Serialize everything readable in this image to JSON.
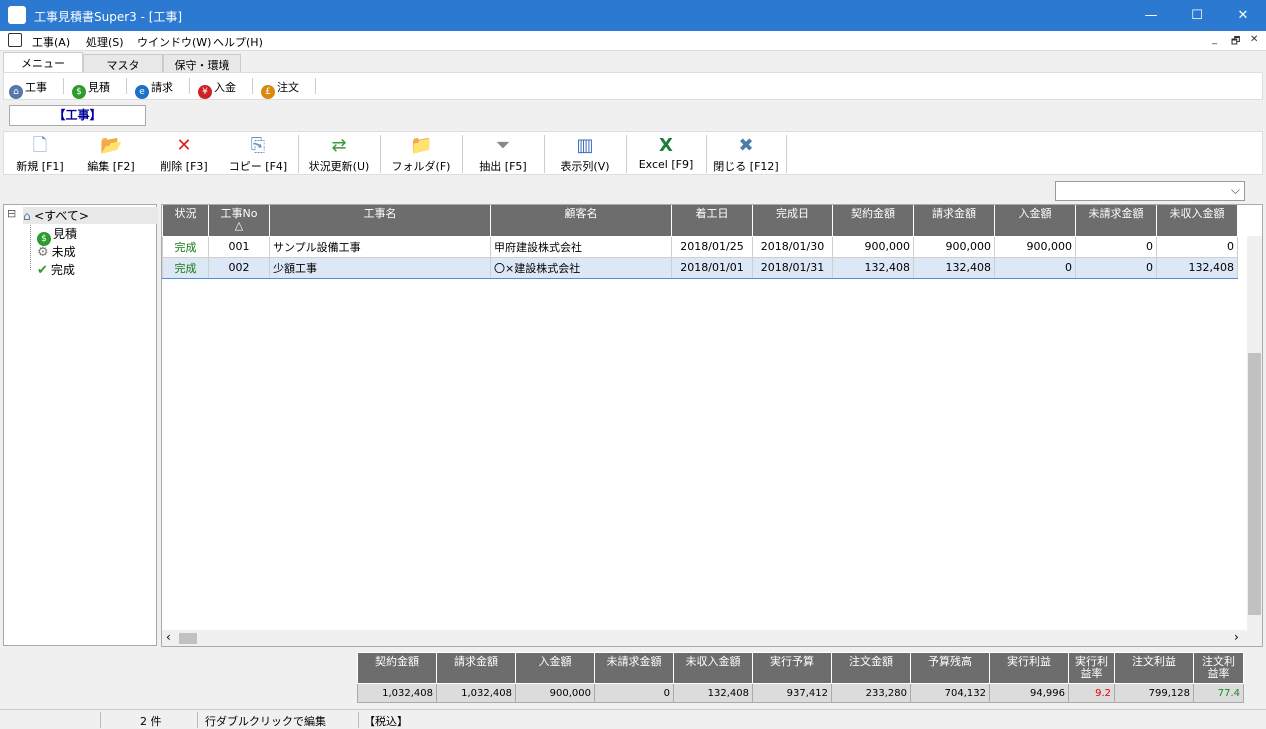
{
  "window": {
    "title": "工事見積書Super3 - [工事]",
    "minimize": "—",
    "maximize": "☐",
    "close": "✕"
  },
  "menu": {
    "items": [
      "工事(A)",
      "処理(S)",
      "ウインドウ(W)",
      "ヘルプ(H)"
    ],
    "mdi": [
      "_",
      "🗗",
      "✕"
    ]
  },
  "tabs": [
    "メニュー",
    "マスタ",
    "保守・環境"
  ],
  "quick": [
    {
      "label": "工事",
      "icon": "house-icon",
      "color": "#5577aa",
      "glyph": "⌂"
    },
    {
      "label": "見積",
      "icon": "dollar-icon",
      "color": "#2e9b2e",
      "glyph": "$"
    },
    {
      "label": "請求",
      "icon": "invoice-icon",
      "color": "#1e6fc8",
      "glyph": "e"
    },
    {
      "label": "入金",
      "icon": "yen-icon",
      "color": "#cc2222",
      "glyph": "¥"
    },
    {
      "label": "注文",
      "icon": "order-icon",
      "color": "#d98a0e",
      "glyph": "£"
    }
  ],
  "mode_label": "【工事】",
  "toolbar": [
    {
      "label": "新規 [F1]",
      "icon": "new-document-icon",
      "glyph": "🗋",
      "color": "#7a9cc8"
    },
    {
      "label": "編集 [F2]",
      "icon": "edit-folder-icon",
      "glyph": "📂",
      "color": "#d6a51c"
    },
    {
      "label": "削除 [F3]",
      "icon": "delete-icon",
      "glyph": "✕",
      "color": "#e02020"
    },
    {
      "label": "コピー [F4]",
      "icon": "copy-icon",
      "glyph": "⎘",
      "color": "#6a8fc0"
    },
    {
      "label": "状況更新(U)",
      "icon": "refresh-icon",
      "glyph": "⇄",
      "color": "#3a9a3a"
    },
    {
      "label": "フォルダ(F)",
      "icon": "folder-icon",
      "glyph": "📁",
      "color": "#d6a51c"
    },
    {
      "label": "抽出 [F5]",
      "icon": "filter-icon",
      "glyph": "⏷",
      "color": "#888888"
    },
    {
      "label": "表示列(V)",
      "icon": "columns-icon",
      "glyph": "▥",
      "color": "#3a6fb8"
    },
    {
      "label": "Excel [F9]",
      "icon": "excel-icon",
      "glyph": "X",
      "color": "#1e7a3e"
    },
    {
      "label": "閉じる [F12]",
      "icon": "close-icon",
      "glyph": "✖",
      "color": "#4a7ea8"
    }
  ],
  "combo": {
    "value": "",
    "arrow": "⌵"
  },
  "tree": {
    "root": "<すべて>",
    "root_toggle": "⊟",
    "root_icon_glyph": "⌂",
    "children": [
      {
        "label": "見積",
        "icon": "dollar-icon",
        "glyph": "$",
        "color": "#2e9b2e"
      },
      {
        "label": "未成",
        "icon": "gears-icon",
        "glyph": "⚙",
        "color": "#777777"
      },
      {
        "label": "完成",
        "icon": "checkmark-icon",
        "glyph": "✔",
        "color": "#2e9b2e"
      }
    ]
  },
  "grid": {
    "headers": [
      "状況",
      "工事No\n△",
      "工事名",
      "顧客名",
      "着工日",
      "完成日",
      "契約金額",
      "請求金額",
      "入金額",
      "未請求金額",
      "未収入金額"
    ],
    "rows": [
      [
        "完成",
        "001",
        "サンプル設備工事",
        "甲府建設株式会社",
        "2018/01/25",
        "2018/01/30",
        "900,000",
        "900,000",
        "900,000",
        "0",
        "0"
      ],
      [
        "完成",
        "002",
        "少額工事",
        "〇×建設株式会社",
        "2018/01/01",
        "2018/01/31",
        "132,408",
        "132,408",
        "0",
        "0",
        "132,408"
      ]
    ],
    "selected_row": 1,
    "scroll_left": "‹",
    "scroll_right": "›"
  },
  "summary": {
    "headers": [
      "契約金額",
      "請求金額",
      "入金額",
      "未請求金額",
      "未収入金額",
      "実行予算",
      "注文金額",
      "予算残高",
      "実行利益",
      "実行利\n益率",
      "注文利益",
      "注文利\n益率"
    ],
    "values": [
      "1,032,408",
      "1,032,408",
      "900,000",
      "0",
      "132,408",
      "937,412",
      "233,280",
      "704,132",
      "94,996",
      "9.2",
      "799,128",
      "77.4"
    ],
    "value_colors": {
      "9": "#e00000",
      "11": "#1a8a1a"
    }
  },
  "status": {
    "count": "2 件",
    "hint": "行ダブルクリックで編集",
    "tax": "【税込】"
  }
}
